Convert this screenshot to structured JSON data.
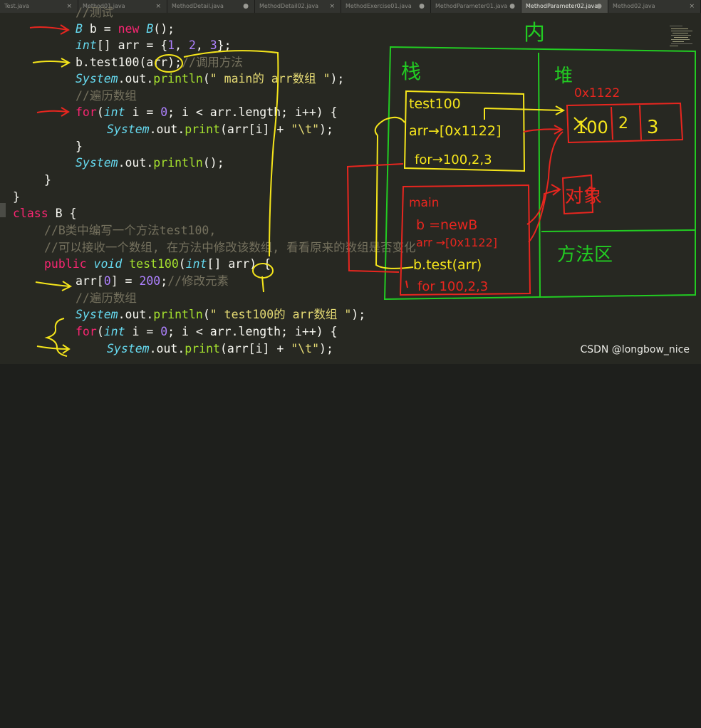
{
  "tabs": [
    {
      "label": "Test.java",
      "close": "×"
    },
    {
      "label": "Method01.java",
      "close": "×"
    },
    {
      "label": "MethodDetail.java",
      "close": "●"
    },
    {
      "label": "MethodDetail02.java",
      "close": "×"
    },
    {
      "label": "MethodExercise01.java",
      "close": "●"
    },
    {
      "label": "MethodParameter01.java",
      "close": "●"
    },
    {
      "label": "MethodParameter02.java",
      "close": "●"
    },
    {
      "label": "Method02.java",
      "close": "×"
    }
  ],
  "active_tab_index": 6,
  "code": {
    "l0_comment": "//测试",
    "l1_b": "B",
    "l1_var": " b = ",
    "l1_new": "new",
    "l1_b2": " B",
    "l1_end": "();",
    "l2_int": "int",
    "l2_mid": "[] arr = {",
    "l2_n1": "1",
    "l2_c1": ", ",
    "l2_n2": "2",
    "l2_c2": ", ",
    "l2_n3": "3",
    "l2_end": "};",
    "l3_call": "b.test100(arr);",
    "l3_comment": "//调用方法",
    "l4_sys": "System",
    "l4_out": ".out.",
    "l4_fn": "println",
    "l4_open": "(",
    "l4_str": "\" main的 arr数组 \"",
    "l4_end": ");",
    "l5_comment": "//遍历数组",
    "l6_for": "for",
    "l6_open": "(",
    "l6_int": "int",
    "l6_mid": " i = ",
    "l6_zero": "0",
    "l6_rest": "; i < arr.length; i++) {",
    "l7_sys": "System",
    "l7_out": ".out.",
    "l7_fn": "print",
    "l7_mid": "(arr[i] + ",
    "l7_str": "\"\\t\"",
    "l7_end": ");",
    "l8": "}",
    "l9_sys": "System",
    "l9_out": ".out.",
    "l9_fn": "println",
    "l9_end": "();",
    "l10": "}",
    "l11": "}",
    "l12_class": "class",
    "l12_name": " B ",
    "l12_brace": "{",
    "l13_comment": "//B类中编写一个方法test100,",
    "l14_comment": "//可以接收一个数组, 在方法中修改该数组, 看看原来的数组是否变化",
    "l15_public": "public",
    "l15_void": "void",
    "l15_fn": "test100",
    "l15_open": "(",
    "l15_int": "int",
    "l15_mid": "[] arr) {",
    "l16_a": "arr[",
    "l16_zero": "0",
    "l16_b": "] = ",
    "l16_num": "200",
    "l16_semi": ";",
    "l16_comment": "//修改元素",
    "l17_comment": "//遍历数组",
    "l18_sys": "System",
    "l18_out": ".out.",
    "l18_fn": "println",
    "l18_open": "(",
    "l18_str": "\" test100的 arr数组 \"",
    "l18_end": ");",
    "l19_for": "for",
    "l19_open": "(",
    "l19_int": "int",
    "l19_mid": " i = ",
    "l19_zero": "0",
    "l19_rest": "; i < arr.length; i++) {",
    "l20_sys": "System",
    "l20_out": ".out.",
    "l20_fn": "print",
    "l20_mid": "(arr[i] + ",
    "l20_str": "\"\\t\"",
    "l20_end": ");"
  },
  "annotations": {
    "heap_title": "内",
    "stack_label": "栈",
    "heap_label": "堆",
    "method_area": "方法区",
    "frame_test100": "test100",
    "arr_ref_test": "arr→[0x1122]",
    "for_test": "for→100,2,3",
    "main_label": "main",
    "b_new": "b =newB",
    "arr_ref_main": "arr →[0x1122]",
    "b_call": "b.test(arr)",
    "for_main": "for 100,2,3",
    "address": "0x1122",
    "cell1": "100",
    "cell2": "2",
    "cell3": "3",
    "object_label": "对象"
  },
  "watermark": "CSDN @longbow_nice",
  "colors": {
    "editor_bg": "#272822",
    "keyword": "#f92672",
    "type": "#66d9ef",
    "number": "#ae81ff",
    "string": "#e6db74",
    "comment": "#75715e",
    "function": "#a6e22e",
    "ink_green": "#22cc22",
    "ink_yellow": "#f5e51b",
    "ink_red": "#e8261f"
  }
}
